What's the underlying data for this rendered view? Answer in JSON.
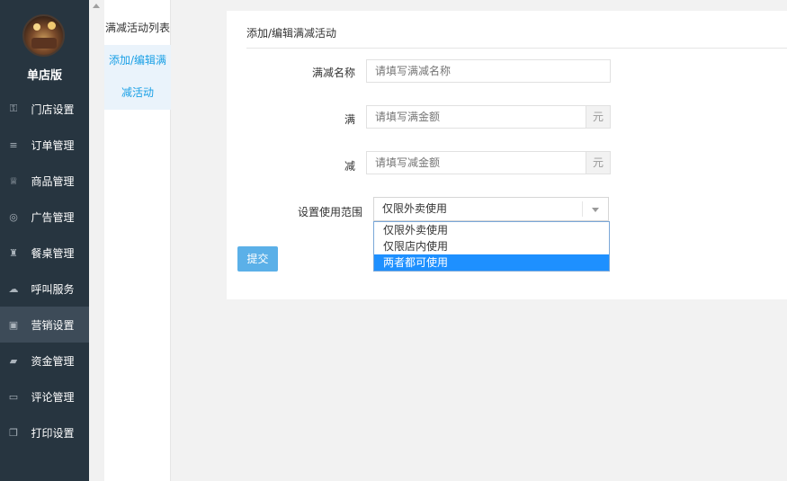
{
  "sidebar": {
    "store_name": "单店版",
    "items": [
      {
        "label": "门店设置",
        "icon": "key-icon",
        "glyph": "⚿"
      },
      {
        "label": "订单管理",
        "icon": "list-icon",
        "glyph": "≡"
      },
      {
        "label": "商品管理",
        "icon": "trophy-icon",
        "glyph": "♕"
      },
      {
        "label": "广告管理",
        "icon": "lifebuoy-icon",
        "glyph": "◎"
      },
      {
        "label": "餐桌管理",
        "icon": "binoculars-icon",
        "glyph": "♜"
      },
      {
        "label": "呼叫服务",
        "icon": "cloud-icon",
        "glyph": "☁"
      },
      {
        "label": "营销设置",
        "icon": "gift-icon",
        "glyph": "▣"
      },
      {
        "label": "资金管理",
        "icon": "book-icon",
        "glyph": "▰"
      },
      {
        "label": "评论管理",
        "icon": "money-icon",
        "glyph": "▭"
      },
      {
        "label": "打印设置",
        "icon": "copy-icon",
        "glyph": "❐"
      }
    ],
    "active_index": 6
  },
  "submenu": {
    "items": [
      {
        "label": "满减活动列表"
      },
      {
        "label_line1": "添加/编辑满",
        "label_line2": "减活动"
      }
    ]
  },
  "form": {
    "title": "添加/编辑满减活动",
    "name_label": "满减名称",
    "name_placeholder": "请填写满减名称",
    "full_label": "满",
    "full_placeholder": "请填写满金额",
    "full_unit": "元",
    "reduce_label": "减",
    "reduce_placeholder": "请填写减金额",
    "reduce_unit": "元",
    "scope_label": "设置使用范围",
    "scope_selected": "仅限外卖使用",
    "scope_options": [
      "仅限外卖使用",
      "仅限店内使用",
      "两者都可使用"
    ],
    "scope_highlight_index": 2,
    "submit_label": "提交"
  }
}
